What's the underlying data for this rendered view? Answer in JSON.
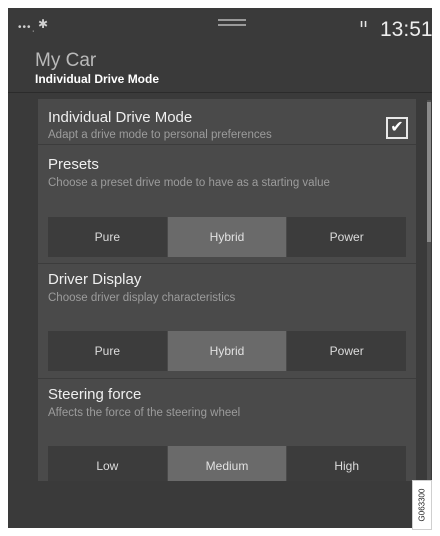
{
  "statusbar": {
    "signal": "•••ˌ",
    "bt": "✱",
    "pause": "ıı",
    "time": "13:51"
  },
  "header": {
    "app_title": "My Car",
    "subtitle": "Individual Drive Mode"
  },
  "rows": {
    "idm": {
      "title": "Individual Drive Mode",
      "desc": "Adapt a drive mode to personal preferences",
      "checked": true,
      "check_glyph": "✔"
    },
    "presets": {
      "title": "Presets",
      "desc": "Choose a preset drive mode to have as a starting value",
      "options": [
        "Pure",
        "Hybrid",
        "Power"
      ],
      "selected": "Hybrid"
    },
    "driver_display": {
      "title": "Driver Display",
      "desc": "Choose driver display characteristics",
      "options": [
        "Pure",
        "Hybrid",
        "Power"
      ],
      "selected": "Hybrid"
    },
    "steering": {
      "title": "Steering force",
      "desc": "Affects the force of the steering wheel",
      "options": [
        "Low",
        "Medium",
        "High"
      ],
      "selected": "Medium"
    }
  },
  "figure_code": "G063300"
}
